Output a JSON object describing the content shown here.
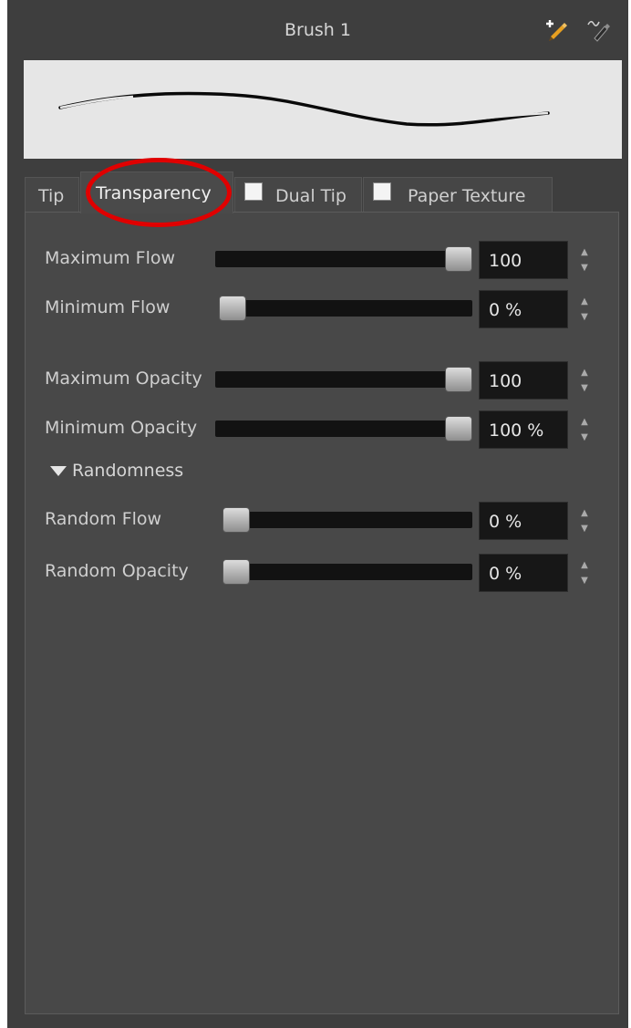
{
  "panel": {
    "title": "Brush 1",
    "icons": {
      "create": "add-brush-icon",
      "rename": "rename-brush-icon"
    }
  },
  "tabs": [
    {
      "label": "Tip",
      "active": false
    },
    {
      "label": "Transparency",
      "active": true
    },
    {
      "label": "Dual Tip",
      "checked": false
    },
    {
      "label": "Paper Texture",
      "checked": false
    }
  ],
  "controls": [
    {
      "label": "Maximum Flow",
      "value": "100",
      "level": 1.0
    },
    {
      "label": "Minimum Flow",
      "value": "0 %",
      "level": 0.0
    },
    {
      "label": "Maximum Opacity",
      "value": "100",
      "level": 1.0
    },
    {
      "label": "Minimum Opacity",
      "value": "100 %",
      "level": 1.0
    }
  ],
  "randomness": {
    "label": "Randomness",
    "expanded": true,
    "controls": [
      {
        "label": "Random Flow",
        "value": "0 %",
        "level": 0.0
      },
      {
        "label": "Random Opacity",
        "value": "0 %",
        "level": 0.0
      }
    ]
  },
  "colors": {
    "panel_bg": "#3e3e3e",
    "content_bg": "#484848",
    "highlight": "#e00000"
  }
}
